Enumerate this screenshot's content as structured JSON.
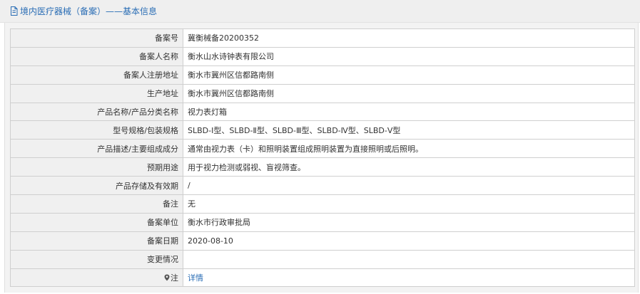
{
  "page": {
    "title": "境内医疗器械（备案）——基本信息"
  },
  "rows": [
    {
      "label": "备案号",
      "value": "冀衡械备20200352"
    },
    {
      "label": "备案人名称",
      "value": "衡水山水诗钟表有限公司"
    },
    {
      "label": "备案人注册地址",
      "value": "衡水市冀州区信都路南侧"
    },
    {
      "label": "生产地址",
      "value": "衡水市冀州区信都路南侧"
    },
    {
      "label": "产品名称/产品分类名称",
      "value": "视力表灯箱"
    },
    {
      "label": "型号规格/包装规格",
      "value": "SLBD-Ⅰ型、SLBD-Ⅱ型、SLBD-Ⅲ型、SLBD-Ⅳ型、SLBD-Ⅴ型"
    },
    {
      "label": "产品描述/主要组成成分",
      "value": "通常由视力表（卡）和照明装置组成照明装置为直接照明或后照明。"
    },
    {
      "label": "预期用途",
      "value": "用于视力检测或弱视、盲视筛查。"
    },
    {
      "label": "产品存储及有效期",
      "value": "/"
    },
    {
      "label": "备注",
      "value": "无"
    },
    {
      "label": "备案单位",
      "value": "衡水市行政审批局"
    },
    {
      "label": "备案日期",
      "value": "2020-08-10"
    },
    {
      "label": "变更情况",
      "value": ""
    }
  ],
  "note_row": {
    "icon": "location-pin-icon",
    "label": "注",
    "link_text": "详情"
  },
  "colors": {
    "accent": "#2a6db5",
    "label_bg": "#f0f0f0",
    "border": "#cfcfcf"
  }
}
